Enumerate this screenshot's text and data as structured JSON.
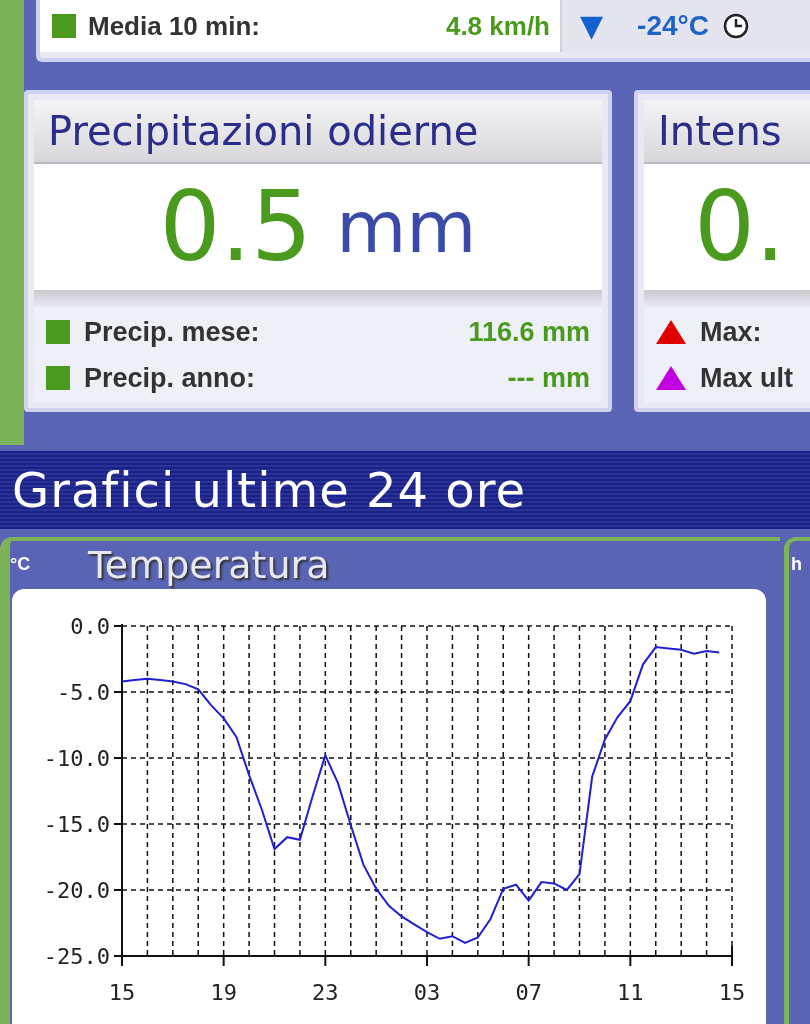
{
  "top_bar": {
    "label": "Media 10 min:",
    "value": "4.8 km/h",
    "trend": "▼",
    "temperature": "-24°C"
  },
  "cards": [
    {
      "title": "Precipitazioni odierne",
      "value": "0.5",
      "unit": "mm",
      "rows": [
        {
          "kind": "square",
          "color": "#4a9a1e",
          "label": "Precip. mese:",
          "value": "116.6 mm"
        },
        {
          "kind": "square",
          "color": "#4a9a1e",
          "label": "Precip. anno:",
          "value": "--- mm"
        }
      ]
    },
    {
      "title": "Intens",
      "value": "0.",
      "rows": [
        {
          "kind": "triangle",
          "color": "#e00000",
          "label": "Max:"
        },
        {
          "kind": "triangle",
          "color": "#c000e0",
          "label": "Max ult"
        }
      ]
    }
  ],
  "section_title": "Grafici ultime 24 ore",
  "charts": [
    {
      "chart_data": {
        "type": "line",
        "title": "Temperatura",
        "ylabel": "°C",
        "categories": [
          "15",
          null,
          null,
          null,
          null,
          null,
          null,
          null,
          "19",
          null,
          null,
          null,
          null,
          null,
          null,
          null,
          "23",
          null,
          null,
          null,
          null,
          null,
          null,
          null,
          "03",
          null,
          null,
          null,
          null,
          null,
          null,
          null,
          "07",
          null,
          null,
          null,
          null,
          null,
          null,
          null,
          "11",
          null,
          null,
          null,
          null,
          null,
          null,
          null,
          "15"
        ],
        "series": [
          {
            "color": "#2020d0",
            "values": [
              -4.2,
              -4.1,
              -4.0,
              -4.1,
              -4.2,
              -4.4,
              -4.8,
              -6.0,
              -7.0,
              -8.4,
              -11.3,
              -13.9,
              -16.9,
              -16.0,
              -16.2,
              -12.9,
              -9.8,
              -11.9,
              -15.1,
              -18.1,
              -19.9,
              -21.2,
              -22.0,
              -22.6,
              -23.2,
              -23.7,
              -23.5,
              -24.0,
              -23.6,
              -22.2,
              -19.9,
              -19.6,
              -20.8,
              -19.4,
              -19.5,
              -20.0,
              -18.8,
              -11.4,
              -8.6,
              -6.9,
              -5.7,
              -2.9,
              -1.6,
              -1.7,
              -1.8,
              -2.1,
              -1.9,
              -2.0,
              null
            ]
          }
        ],
        "ylim": [
          -25,
          0
        ],
        "grid": true,
        "yticks": [
          {
            "value": 0,
            "label": "0.0"
          },
          {
            "value": -5,
            "label": "-5.0"
          },
          {
            "value": -10,
            "label": "-10.0"
          },
          {
            "value": -15,
            "label": "-15.0"
          },
          {
            "value": -20,
            "label": "-20.0"
          },
          {
            "value": -25,
            "label": "-25.0"
          }
        ]
      }
    }
  ],
  "next_panel": {
    "unit": "h"
  }
}
